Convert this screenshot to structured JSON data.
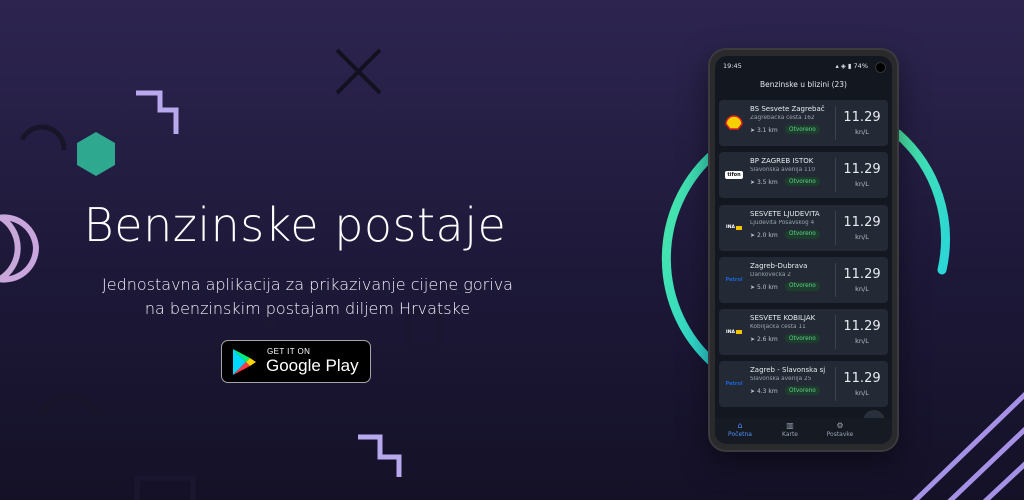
{
  "hero": {
    "title": "Benzinske postaje",
    "subtitle_line1": "Jednostavna aplikacija za prikazivanje cijene goriva",
    "subtitle_line2": "na benzinskim postajam diljem Hrvatske"
  },
  "store_badge": {
    "small": "GET IT ON",
    "big": "Google Play"
  },
  "phone": {
    "status_time": "19:45",
    "battery": "74%",
    "app_title": "Benzinske u blizini (23)",
    "stations": [
      {
        "name": "BS Sesvete Zagrebač",
        "address": "Zagrebačka cesta 162",
        "distance": "3.1 km",
        "status": "Otvoreno",
        "price": "11.29",
        "unit": "kn/L",
        "brand": "shell",
        "brand_label": "Shell"
      },
      {
        "name": "BP ZAGREB ISTOK",
        "address": "Slavonska avenija 110",
        "distance": "3.5 km",
        "status": "Otvoreno",
        "price": "11.29",
        "unit": "kn/L",
        "brand": "tifon",
        "brand_label": "Tifon"
      },
      {
        "name": "SESVETE LJUDEVITA",
        "address": "Ljudevita Posavskog 4",
        "distance": "2.0 km",
        "status": "Otvoreno",
        "price": "11.29",
        "unit": "kn/L",
        "brand": "ina",
        "brand_label": "INA"
      },
      {
        "name": "Zagreb-Dubrava",
        "address": "Dankovečka 2",
        "distance": "5.0 km",
        "status": "Otvoreno",
        "price": "11.29",
        "unit": "kn/L",
        "brand": "petrol",
        "brand_label": "Petrol"
      },
      {
        "name": "SESVETE KOBILJAK",
        "address": "Kobiljačka cesta 11",
        "distance": "2.6 km",
        "status": "Otvoreno",
        "price": "11.29",
        "unit": "kn/L",
        "brand": "ina",
        "brand_label": "INA"
      },
      {
        "name": "Zagreb - Slavonska sj",
        "address": "Slavonska avenija 25",
        "distance": "4.3 km",
        "status": "Otvoreno",
        "price": "11.29",
        "unit": "kn/L",
        "brand": "petrol",
        "brand_label": "Petrol"
      }
    ],
    "nav": [
      {
        "label": "Početna",
        "icon": "home-icon",
        "glyph": "⌂"
      },
      {
        "label": "Karte",
        "icon": "map-icon",
        "glyph": "▥"
      },
      {
        "label": "Postavke",
        "icon": "gear-icon",
        "glyph": "⚙"
      }
    ],
    "fab_icon": "filter-icon"
  },
  "colors": {
    "arc_start": "#47e6a8",
    "arc_end": "#2fd9d2",
    "nav_active": "#4d90ff",
    "badge_text": "#5fd08b"
  }
}
